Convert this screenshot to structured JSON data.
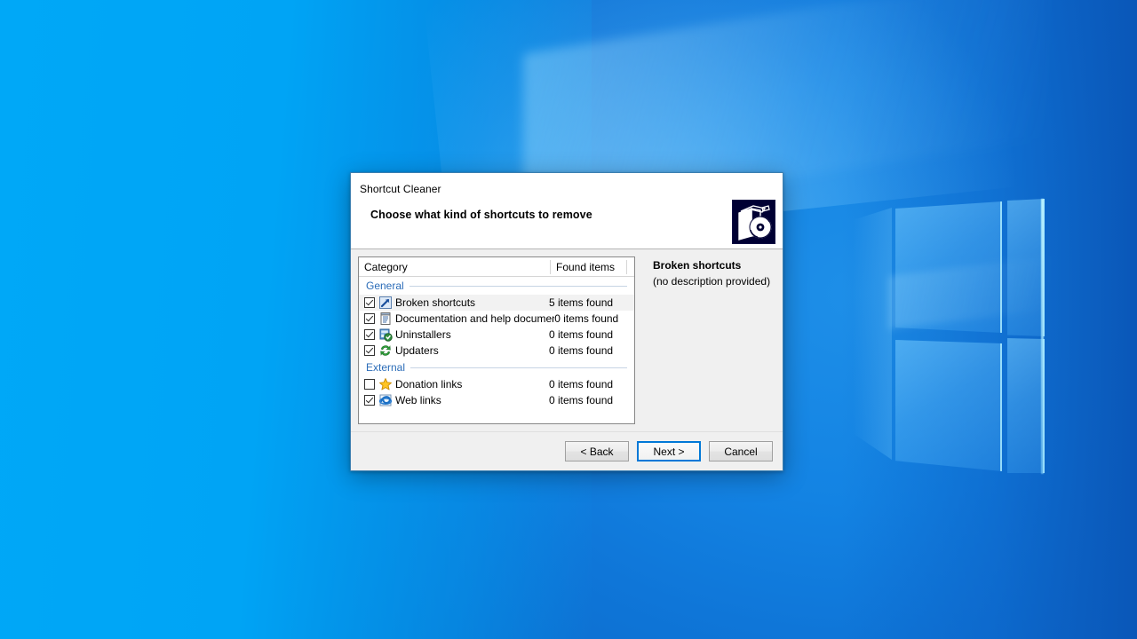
{
  "desktop": {
    "wallpaper_name": "windows-10-hero-wallpaper",
    "colors": {
      "left_blue": "#00a6f5",
      "deep_blue": "#0a5fc0",
      "logo_glow": "#8ad4ff"
    }
  },
  "dialog": {
    "window_title": "Shortcut Cleaner",
    "heading": "Choose what kind of shortcuts to remove",
    "app_icon": "software-box-cd-icon",
    "accent_color": "#0078d7",
    "list": {
      "columns": {
        "category": "Category",
        "found_items": "Found items"
      },
      "groups": [
        {
          "label": "General",
          "rows": [
            {
              "checked": true,
              "icon": "broken-shortcut-arrow-icon",
              "label": "Broken shortcuts",
              "count": "5 items found",
              "selected": true
            },
            {
              "checked": true,
              "icon": "document-help-icon",
              "label": "Documentation and help documents",
              "count": "0 items found",
              "selected": false
            },
            {
              "checked": true,
              "icon": "uninstaller-icon",
              "label": "Uninstallers",
              "count": "0 items found",
              "selected": false
            },
            {
              "checked": true,
              "icon": "updater-refresh-icon",
              "label": "Updaters",
              "count": "0 items found",
              "selected": false
            }
          ]
        },
        {
          "label": "External",
          "rows": [
            {
              "checked": false,
              "icon": "donation-star-icon",
              "label": "Donation links",
              "count": "0 items found",
              "selected": false
            },
            {
              "checked": true,
              "icon": "web-link-browser-icon",
              "label": "Web links",
              "count": "0 items found",
              "selected": false
            }
          ]
        }
      ]
    },
    "description": {
      "title": "Broken shortcuts",
      "text": "(no description provided)"
    },
    "footer": {
      "back_label": "< Back",
      "next_label": "Next >",
      "cancel_label": "Cancel",
      "focused_button": "next"
    }
  }
}
